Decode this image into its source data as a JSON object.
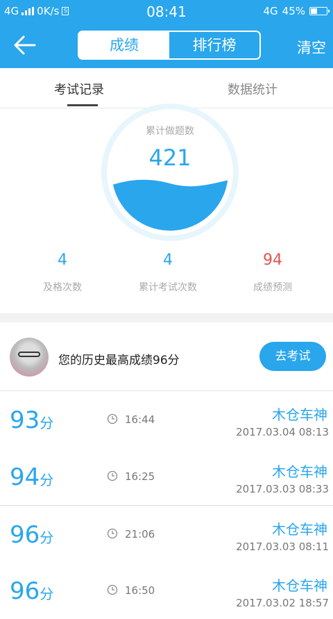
{
  "status_bar": {
    "network_left": "4G",
    "speed": "0K/s",
    "time": "08:41",
    "network_right": "4G",
    "battery": "45%"
  },
  "navbar": {
    "back_icon": "arrow-left-icon",
    "segments": [
      "成绩",
      "排行榜"
    ],
    "active_segment": 0,
    "clear_label": "清空"
  },
  "tabs": {
    "items": [
      "考试记录",
      "数据统计"
    ],
    "active": 0
  },
  "summary": {
    "circle_title": "累计做题数",
    "total_questions": "421",
    "stats": [
      {
        "value": "4",
        "label": "及格次数"
      },
      {
        "value": "4",
        "label": "累计考试次数"
      },
      {
        "value": "94",
        "label": "成绩预测"
      }
    ]
  },
  "best": {
    "text": "您的历史最高成绩96分",
    "button": "去考试"
  },
  "records": [
    {
      "score": "93",
      "unit": "分",
      "duration": "16:44",
      "user": "木仓车神",
      "date": "2017.03.04  08:13"
    },
    {
      "score": "94",
      "unit": "分",
      "duration": "16:25",
      "user": "木仓车神",
      "date": "2017.03.03  08:33"
    },
    {
      "score": "96",
      "unit": "分",
      "duration": "21:06",
      "user": "木仓车神",
      "date": "2017.03.03  08:11"
    },
    {
      "score": "96",
      "unit": "分",
      "duration": "16:50",
      "user": "木仓车神",
      "date": "2017.03.02  18:57"
    }
  ],
  "colors": {
    "accent": "#29a6ec",
    "prediction": "#e2554f"
  }
}
